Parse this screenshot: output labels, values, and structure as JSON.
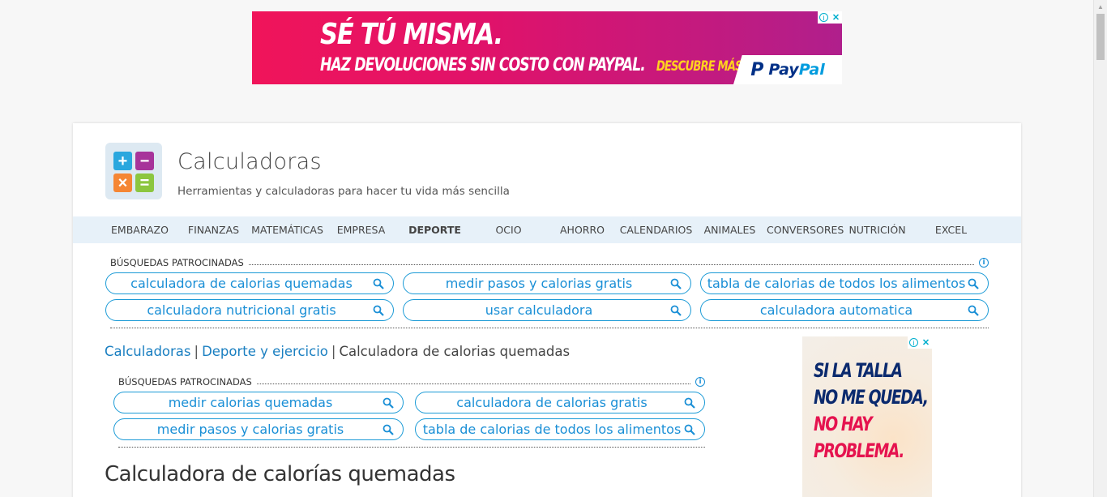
{
  "top_ad": {
    "headline": "SÉ TÚ MISMA.",
    "subline": "HAZ DEVOLUCIONES SIN COSTO CON PAYPAL.",
    "cta": "DESCUBRE MÁS",
    "brand_mark": "P",
    "brand_pay": "Pay",
    "brand_pal": "Pal",
    "info_glyph": "i",
    "close_glyph": "✕"
  },
  "site": {
    "title": "Calculadoras",
    "subtitle": "Herramientas y calculadoras para hacer tu vida más sencilla",
    "logo_glyphs": [
      "+",
      "−",
      "×",
      "="
    ]
  },
  "nav": {
    "items": [
      {
        "label": "EMBARAZO"
      },
      {
        "label": "FINANZAS"
      },
      {
        "label": "MATEMÁTICAS"
      },
      {
        "label": "EMPRESA"
      },
      {
        "label": "DEPORTE",
        "active": true
      },
      {
        "label": "OCIO"
      },
      {
        "label": "AHORRO"
      },
      {
        "label": "CALENDARIOS"
      },
      {
        "label": "ANIMALES"
      },
      {
        "label": "CONVERSORES"
      },
      {
        "label": "NUTRICIÓN"
      },
      {
        "label": "EXCEL"
      }
    ]
  },
  "sponsored_top": {
    "heading": "BÚSQUEDAS PATROCINADAS",
    "info_glyph": "i",
    "items": [
      "calculadora de calorias quemadas",
      "medir pasos y calorias gratis",
      "tabla de calorias de todos los alimentos",
      "calculadora nutricional gratis",
      "usar calculadora",
      "calculadora automatica"
    ]
  },
  "breadcrumb": {
    "home": "Calculadoras",
    "section": "Deporte y ejercicio",
    "current": "Calculadora de calorias quemadas",
    "separator": "|"
  },
  "sponsored_inner": {
    "heading": "BÚSQUEDAS PATROCINADAS",
    "info_glyph": "i",
    "items": [
      "medir calorias quemadas",
      "calculadora de calorias gratis",
      "medir pasos y calorias gratis",
      "tabla de calorias de todos los alimentos"
    ]
  },
  "page_title": "Calculadora de calorías quemadas",
  "side_ad": {
    "line1": "SI LA TALLA",
    "line2": "NO ME QUEDA,",
    "line3": "NO HAY",
    "line4": "PROBLEMA.",
    "info_glyph": "i",
    "close_glyph": "✕"
  },
  "colors": {
    "accent_link": "#1a8fd6",
    "nav_bg": "#e7f1f9",
    "ad_pink": "#f0145a",
    "paypal_navy": "#003087"
  }
}
